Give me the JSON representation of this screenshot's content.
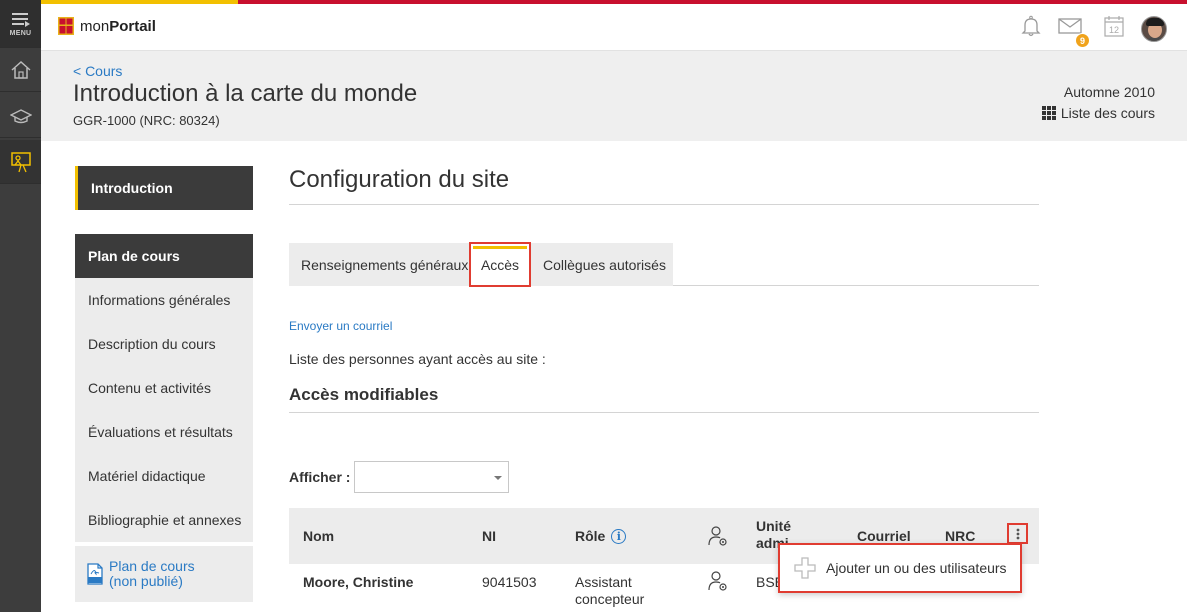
{
  "rail": {
    "menu_label": "MENU"
  },
  "topbar": {
    "brand_prefix": "mon",
    "brand_bold": "Portail",
    "mail_count": "9",
    "calendar_day": "12"
  },
  "course": {
    "back_link": "< Cours",
    "title": "Introduction à la carte du monde",
    "code": "GGR-1000 (NRC: 80324)",
    "session": "Automne 2010",
    "course_list": "Liste des cours"
  },
  "nav": {
    "intro": "Introduction",
    "plan": "Plan de cours",
    "items": [
      "Informations générales",
      "Description du cours",
      "Contenu et activités",
      "Évaluations et résultats",
      "Matériel didactique",
      "Bibliographie et annexes"
    ],
    "pdf_line1": "Plan de cours",
    "pdf_line2": "(non publié)"
  },
  "main": {
    "title": "Configuration du site",
    "tabs": [
      "Renseignements généraux",
      "Accès",
      "Collègues autorisés"
    ],
    "email_link": "Envoyer un courriel",
    "list_label": "Liste des personnes ayant accès au site :",
    "section_title": "Accès modifiables",
    "afficher_label": "Afficher :",
    "afficher_value": ""
  },
  "table": {
    "headers": {
      "nom": "Nom",
      "ni": "NI",
      "role": "Rôle",
      "unite": "Unité admi",
      "courriel": "Courriel",
      "nrc": "NRC"
    },
    "rows": [
      {
        "nom": "Moore, Christine",
        "ni": "9041503",
        "role_line1": "Assistant",
        "role_line2": "concepteur",
        "unite": "BSE"
      }
    ]
  },
  "menu": {
    "add_users": "Ajouter un ou des utilisateurs"
  },
  "colors": {
    "accent_yellow": "#f2c000",
    "accent_red": "#c8102e",
    "link_blue": "#2a7ac4",
    "highlight_red": "#e03c31"
  }
}
